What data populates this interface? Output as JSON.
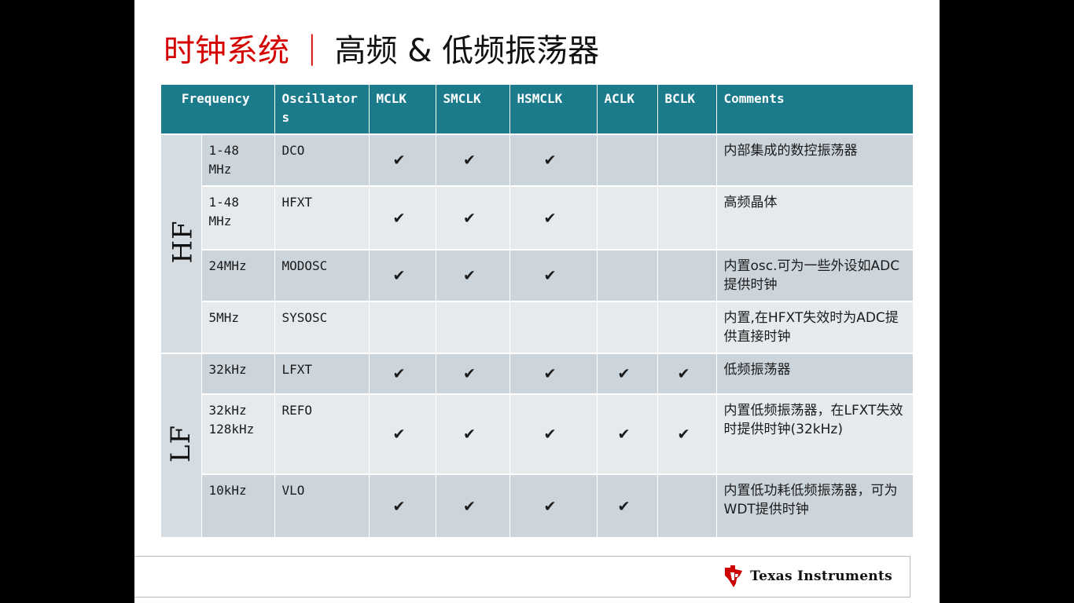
{
  "title": {
    "part1": "时钟系统",
    "separator": "|",
    "part2": "高频 & 低频振荡器"
  },
  "table": {
    "headers": {
      "frequency": "Frequency",
      "oscillators": "Oscillators",
      "mclk": "MCLK",
      "smclk": "SMCLK",
      "hsmclk": "HSMCLK",
      "aclk": "ACLK",
      "bclk": "BCLK",
      "comments": "Comments"
    },
    "check_symbol": "✔",
    "groups": {
      "hf": "HF",
      "lf": "LF"
    },
    "rows": [
      {
        "freq": "1-48 MHz",
        "osc": "DCO",
        "mclk": "✔",
        "smclk": "✔",
        "hsmclk": "✔",
        "aclk": "",
        "bclk": "",
        "comment": "内部集成的数控振荡器"
      },
      {
        "freq": "1-48 MHz",
        "osc": "HFXT",
        "mclk": "✔",
        "smclk": "✔",
        "hsmclk": "✔",
        "aclk": "",
        "bclk": "",
        "comment": "高频晶体"
      },
      {
        "freq": "24MHz",
        "osc": "MODOSC",
        "mclk": "✔",
        "smclk": "✔",
        "hsmclk": "✔",
        "aclk": "",
        "bclk": "",
        "comment": "内置osc.可为一些外设如ADC提供时钟"
      },
      {
        "freq": "5MHz",
        "osc": "SYSOSC",
        "mclk": "",
        "smclk": "",
        "hsmclk": "",
        "aclk": "",
        "bclk": "",
        "comment": "内置,在HFXT失效时为ADC提供直接时钟"
      },
      {
        "freq": "32kHz",
        "osc": "LFXT",
        "mclk": "✔",
        "smclk": "✔",
        "hsmclk": "✔",
        "aclk": "✔",
        "bclk": "✔",
        "comment": "低频振荡器"
      },
      {
        "freq": "32kHz 128kHz",
        "osc": "REFO",
        "mclk": "✔",
        "smclk": "✔",
        "hsmclk": "✔",
        "aclk": "✔",
        "bclk": "✔",
        "comment": "内置低频振荡器，在LFXT失效时提供时钟(32kHz)"
      },
      {
        "freq": "10kHz",
        "osc": "VLO",
        "mclk": "✔",
        "smclk": "✔",
        "hsmclk": "✔",
        "aclk": "✔",
        "bclk": "",
        "comment": "内置低功耗低频振荡器，可为WDT提供时钟"
      }
    ]
  },
  "footer": {
    "brand": "Texas Instruments",
    "brand_color": "#cc0000"
  },
  "colors": {
    "header_teal": "#1c7b8b",
    "title_red": "#d40000",
    "row_dark": "#cdd5dc",
    "row_light": "#e5eaed"
  }
}
